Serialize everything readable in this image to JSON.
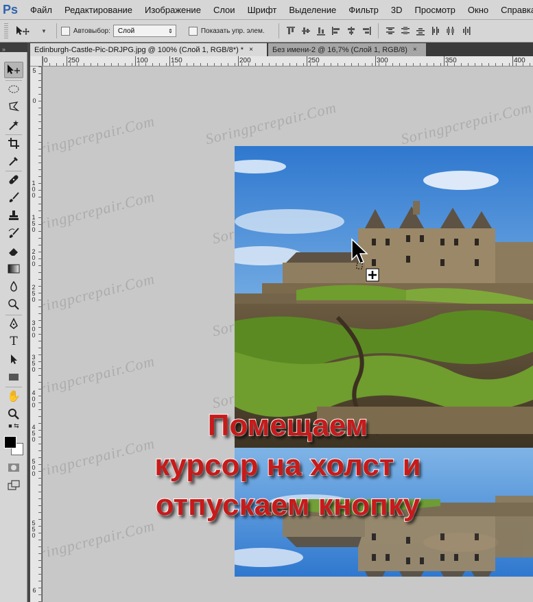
{
  "app": {
    "logo": "Ps"
  },
  "menu": [
    "Файл",
    "Редактирование",
    "Изображение",
    "Слои",
    "Шрифт",
    "Выделение",
    "Фильтр",
    "3D",
    "Просмотр",
    "Окно",
    "Справка"
  ],
  "options": {
    "autoselect_label": "Автовыбор:",
    "autoselect_value": "Слой",
    "show_controls_label": "Показать упр. элем."
  },
  "toolbox": {
    "header": "»"
  },
  "tabs": [
    {
      "label": "Edinburgh-Castle-Pic-DRJPG.jpg @ 100% (Слой 1, RGB/8*) *",
      "close": "×"
    },
    {
      "label": "Без имени-2 @ 16,7% (Слой 1, RGB/8)",
      "close": "×"
    }
  ],
  "ruler_h": [
    "0",
    "250",
    "100",
    "150",
    "200",
    "250",
    "300",
    "350",
    "400"
  ],
  "ruler_v": [
    "5",
    "0",
    "1 0 0",
    "1 5 0",
    "2 0 0",
    "2 5 0",
    "3 0 0",
    "3 5 0",
    "4 0 0",
    "4 5 0",
    "5 0 0",
    "5 5 0",
    "6"
  ],
  "watermark": "Soringpcrepair.Com",
  "caption": {
    "line1": "Помещаем",
    "line2": "курсор на холст и",
    "line3": "отпускаем кнопку"
  },
  "colors": {
    "caption": "#c81a1a",
    "sky": "#4a8fd6",
    "stone": "#8a7a5e",
    "grass": "#6e9a2a"
  }
}
